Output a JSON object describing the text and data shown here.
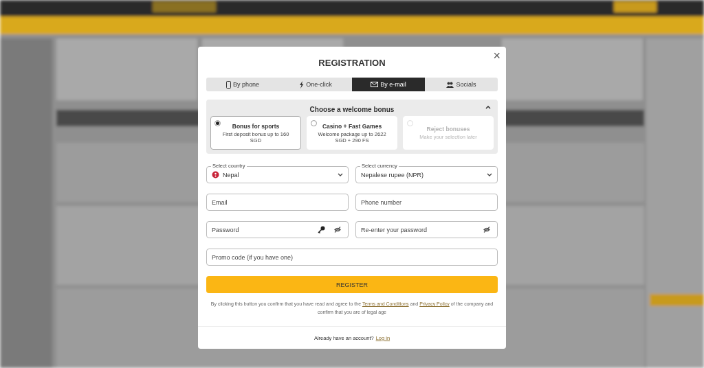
{
  "dialog": {
    "title": "REGISTRATION",
    "close": "×",
    "tabs": [
      {
        "label": "By phone",
        "kind": "phone",
        "selected": false
      },
      {
        "label": "One-click",
        "kind": "bolt",
        "selected": false
      },
      {
        "label": "By e-mail",
        "kind": "mail",
        "selected": true
      },
      {
        "label": "Socials",
        "kind": "people",
        "selected": false
      }
    ],
    "bonus": {
      "title": "Choose a welcome bonus",
      "expanded": true,
      "options": [
        {
          "title": "Bonus for sports",
          "text": "First deposit bonus up to 160 SGD",
          "selected": true,
          "disabled": false
        },
        {
          "title": "Casino + Fast Games",
          "text": "Welcome package up to 2622 SGD + 290 FS",
          "selected": false,
          "disabled": false
        },
        {
          "title": "Reject bonuses",
          "text": "Make your selection later",
          "selected": false,
          "disabled": true
        }
      ]
    },
    "fields": [
      {
        "kind": "flagselect",
        "label": "Select country",
        "value": "Nepal"
      },
      {
        "kind": "select",
        "label": "Select currency",
        "value": "Nepalese rupee (NPR)"
      },
      {
        "kind": "text",
        "placeholder": "Email"
      },
      {
        "kind": "text",
        "placeholder": "Phone number"
      },
      {
        "kind": "keypassword",
        "placeholder": "Password"
      },
      {
        "kind": "password",
        "placeholder": "Re-enter your password"
      },
      {
        "kind": "widetext",
        "placeholder": "Promo code (if you have one)"
      }
    ],
    "register": "REGISTER",
    "legal": {
      "before": "By clicking this button you confirm that you have read and agree to the",
      "links": [
        "Terms and Conditions",
        "Privacy Policy"
      ],
      "between": "and",
      "after": "of the company and confirm that you are of legal age"
    },
    "footer": {
      "text": "Already have an account?",
      "link": "Log in"
    }
  }
}
